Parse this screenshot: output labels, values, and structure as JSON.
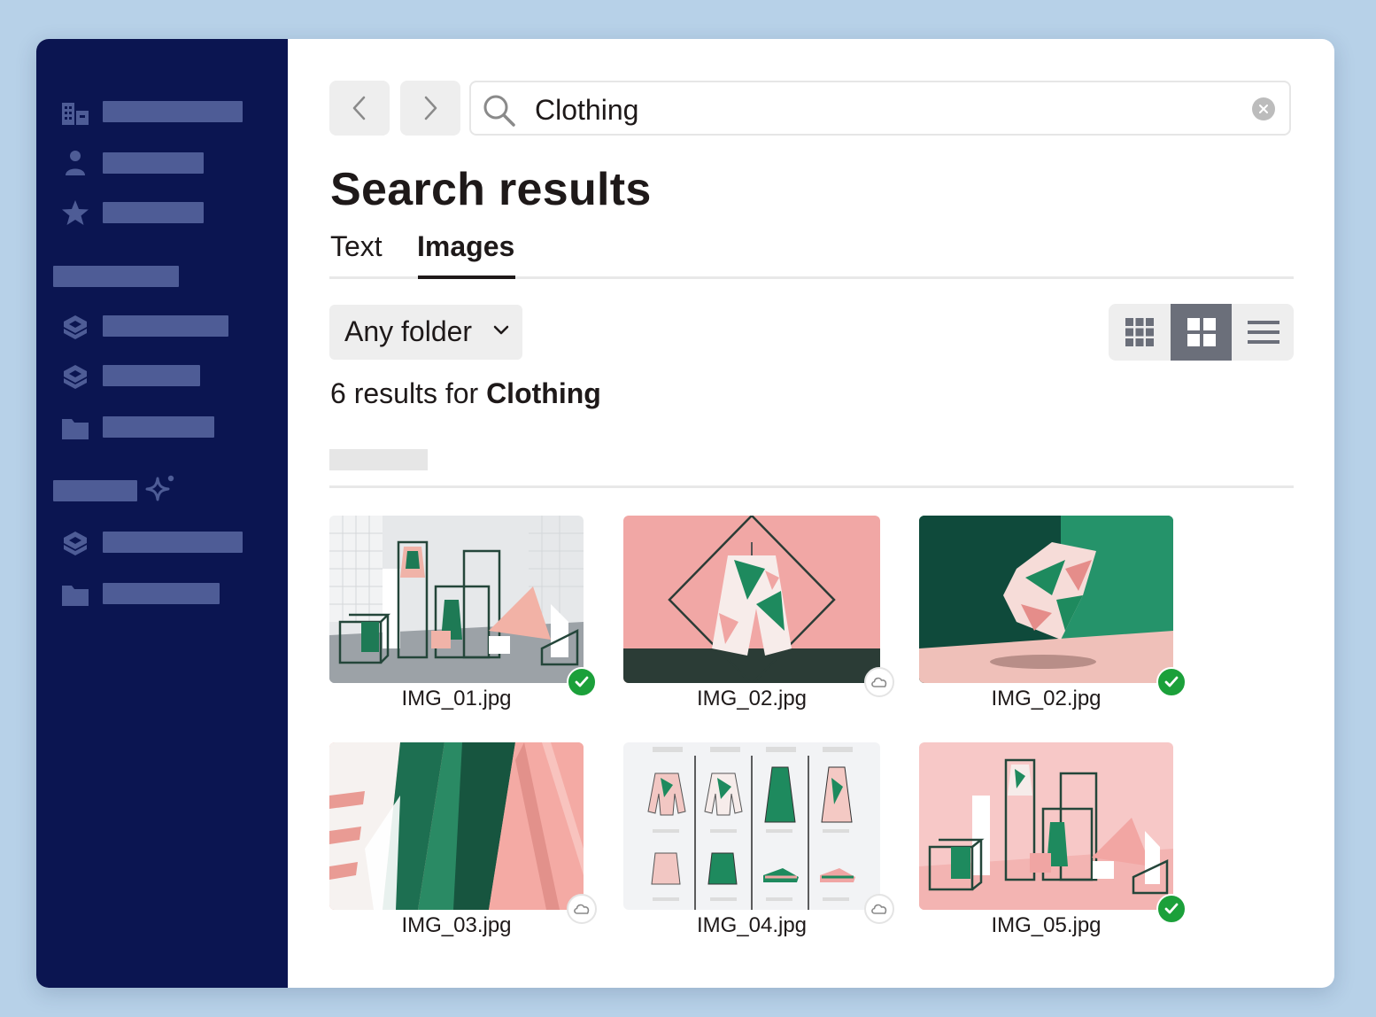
{
  "search": {
    "query": "Clothing"
  },
  "page": {
    "title": "Search results"
  },
  "tabs": [
    {
      "label": "Text"
    },
    {
      "label": "Images"
    }
  ],
  "filters": {
    "folder_label": "Any folder"
  },
  "results": {
    "count_text": "6 results for ",
    "query_bold": "Clothing"
  },
  "files": [
    {
      "name": "IMG_01.jpg",
      "status": "synced"
    },
    {
      "name": "IMG_02.jpg",
      "status": "cloud"
    },
    {
      "name": "IMG_02.jpg",
      "status": "synced"
    },
    {
      "name": "IMG_03.jpg",
      "status": "cloud"
    },
    {
      "name": "IMG_04.jpg",
      "status": "cloud"
    },
    {
      "name": "IMG_05.jpg",
      "status": "synced"
    }
  ],
  "colors": {
    "sidebar_bg": "#0b1551",
    "sidebar_placeholder": "#4e5c96",
    "synced_badge": "#1ba03a",
    "pink": "#f0a5a3",
    "green": "#1e8a5e"
  }
}
